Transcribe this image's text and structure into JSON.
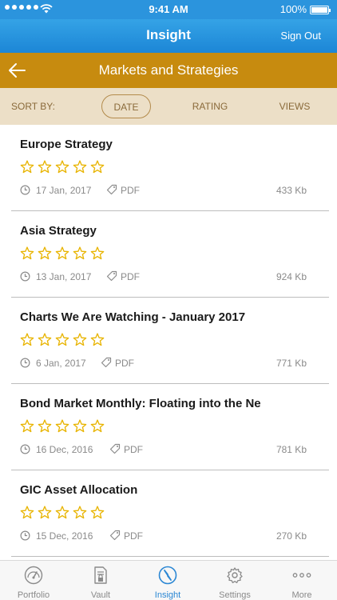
{
  "status": {
    "time": "9:41 AM",
    "battery": "100%"
  },
  "nav": {
    "title": "Insight",
    "sign_out": "Sign Out"
  },
  "section": {
    "title": "Markets and Strategies"
  },
  "sort": {
    "label": "SORT BY:",
    "options": [
      "DATE",
      "RATING",
      "VIEWS"
    ],
    "selected": "DATE"
  },
  "items": [
    {
      "title": "Europe Strategy",
      "rating": 0,
      "date": "17 Jan, 2017",
      "type": "PDF",
      "size": "433 Kb"
    },
    {
      "title": "Asia Strategy",
      "rating": 0,
      "date": "13 Jan, 2017",
      "type": "PDF",
      "size": "924 Kb"
    },
    {
      "title": "Charts We Are Watching - January 2017",
      "rating": 0,
      "date": "6 Jan, 2017",
      "type": "PDF",
      "size": "771 Kb"
    },
    {
      "title": "Bond Market Monthly: Floating into the Ne",
      "rating": 0,
      "date": "16 Dec, 2016",
      "type": "PDF",
      "size": "781 Kb"
    },
    {
      "title": "GIC Asset Allocation",
      "rating": 0,
      "date": "15 Dec, 2016",
      "type": "PDF",
      "size": "270 Kb"
    }
  ],
  "tabs": [
    {
      "label": "Portfolio",
      "icon": "gauge-icon"
    },
    {
      "label": "Vault",
      "icon": "locked-document-icon"
    },
    {
      "label": "Insight",
      "icon": "compass-icon",
      "active": true
    },
    {
      "label": "Settings",
      "icon": "gear-icon"
    },
    {
      "label": "More",
      "icon": "ellipsis-icon"
    }
  ],
  "colors": {
    "nav": "#2b94dd",
    "section": "#c78b0f",
    "sort_bar": "#ecdfc7",
    "star": "#e8b400",
    "active_tab": "#2b87d4"
  }
}
